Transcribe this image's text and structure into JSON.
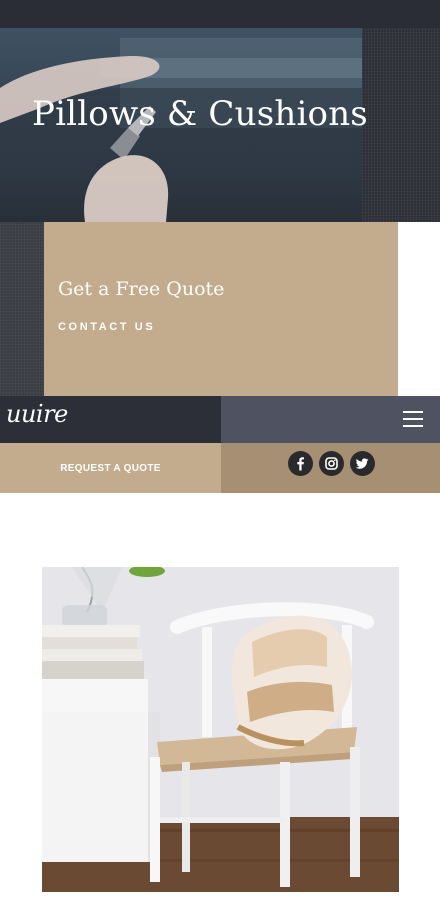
{
  "hero": {
    "title": "Pillows & Cushions"
  },
  "quote": {
    "heading": "Get a Free Quote",
    "contact_label": "CONTACT US"
  },
  "header": {
    "logo_text": "uuire",
    "menu_icon": "hamburger-menu-icon"
  },
  "request_bar": {
    "request_label": "REQUEST A QUOTE",
    "social": [
      {
        "name": "facebook",
        "icon": "facebook-icon"
      },
      {
        "name": "instagram",
        "icon": "instagram-icon"
      },
      {
        "name": "twitter",
        "icon": "twitter-icon"
      }
    ]
  },
  "colors": {
    "dark": "#2c2f38",
    "slate": "#4f5260",
    "sand": "#c3ab8d",
    "taupe": "#a78f74",
    "white": "#ffffff"
  }
}
